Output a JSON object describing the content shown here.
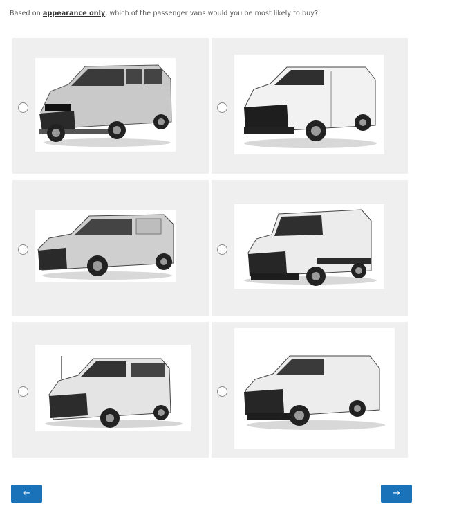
{
  "question": {
    "prefix": "Based on ",
    "emphasis": "appearance only",
    "suffix": ", which of the passenger vans would you be most likely to buy?"
  },
  "options": [
    {
      "icon": "van-passenger-extended-image"
    },
    {
      "icon": "van-cargo-image"
    },
    {
      "icon": "van-compact-image"
    },
    {
      "icon": "van-high-roof-image"
    },
    {
      "icon": "van-passenger-transit-image"
    },
    {
      "icon": "van-high-roof-cargo-image"
    }
  ],
  "nav": {
    "prev_label": "←",
    "next_label": "→"
  },
  "colors": {
    "button": "#1a73b8",
    "cell_bg": "#efefef"
  }
}
